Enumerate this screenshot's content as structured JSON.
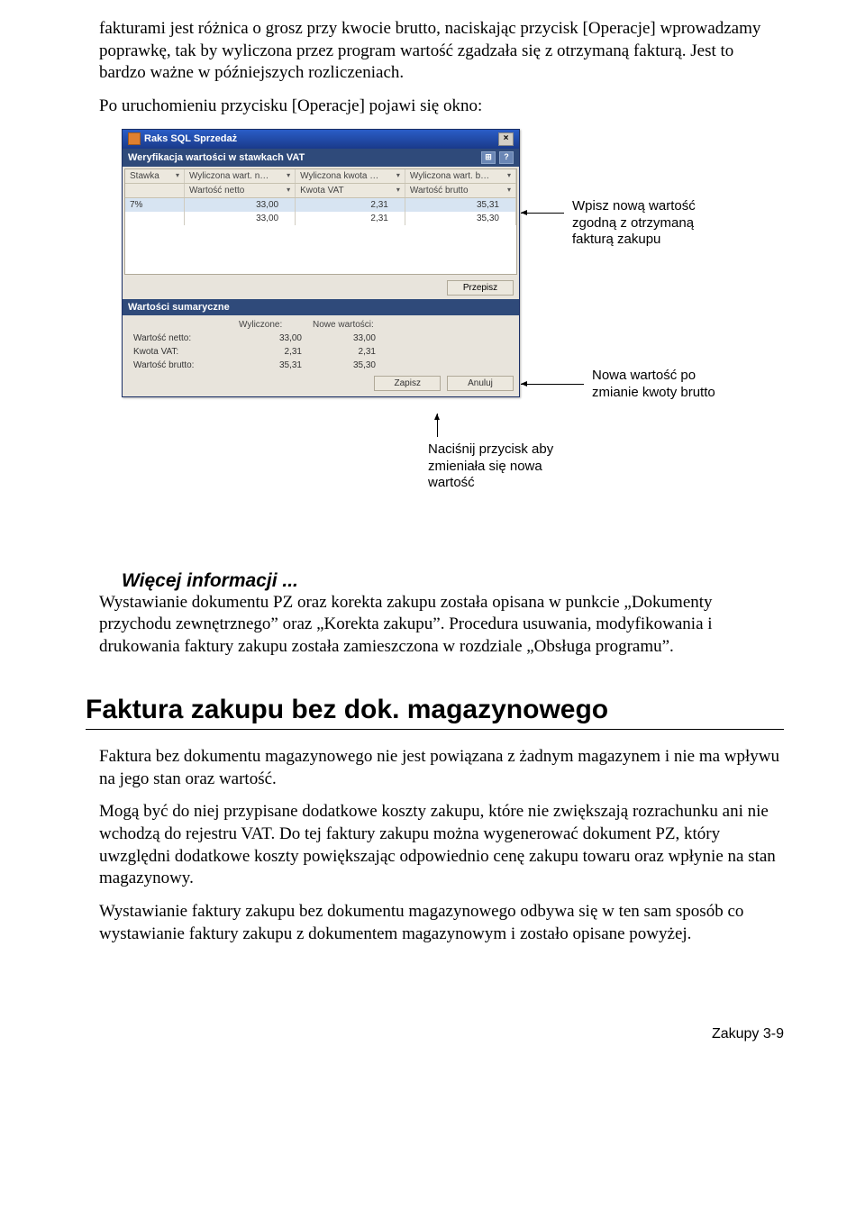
{
  "para1": "fakturami jest różnica o grosz przy kwocie brutto, naciskając przycisk [Operacje] wprowadzamy poprawkę, tak by wyliczona przez program wartość zgadzała się z otrzymaną fakturą. Jest to bardzo ważne w późniejszych rozliczeniach.",
  "para2": "Po uruchomieniu przycisku [Operacje] pojawi się okno:",
  "window": {
    "title": "Raks SQL Sprzedaż",
    "subtitle": "Weryfikacja wartości w stawkach VAT",
    "icon_help": "?",
    "icon_grid": "⊞",
    "headers_top": [
      "Stawka",
      "Wyliczona wart. n…",
      "Wyliczona kwota …",
      "Wyliczona wart. b…"
    ],
    "headers_bottom": [
      "",
      "Wartość netto",
      "Kwota VAT",
      "Wartość brutto"
    ],
    "rows": [
      [
        "7%",
        "33,00",
        "2,31",
        "35,31"
      ],
      [
        "",
        "33,00",
        "2,31",
        "35,30"
      ]
    ],
    "btn_przepisz": "Przepisz",
    "summary_title": "Wartości sumaryczne",
    "summary_cols": [
      "",
      "Wyliczone:",
      "Nowe wartości:"
    ],
    "summary_rows": [
      [
        "Wartość netto:",
        "33,00",
        "33,00"
      ],
      [
        "Kwota VAT:",
        "2,31",
        "2,31"
      ],
      [
        "Wartość brutto:",
        "35,31",
        "35,30"
      ]
    ],
    "btn_zapisz": "Zapisz",
    "btn_anuluj": "Anuluj"
  },
  "anno1": "Wpisz nową wartość zgodną z otrzymaną fakturą zakupu",
  "anno2": "Nowa wartość po zmianie kwoty brutto",
  "anno3": "Naciśnij przycisk aby zmieniała się nowa wartość",
  "more_info_head": "Więcej informacji ...",
  "more_info_body": "Wystawianie dokumentu PZ oraz korekta zakupu została opisana w punkcie „Dokumenty przychodu zewnętrznego” oraz „Korekta zakupu”. Procedura usuwania, modyfikowania i drukowania faktury zakupu została zamieszczona w rozdziale „Obsługa programu”.",
  "h1": "Faktura zakupu bez dok. magazynowego",
  "sec_p1": "Faktura bez dokumentu magazynowego nie jest powiązana z żadnym magazynem i nie ma wpływu na jego stan oraz wartość.",
  "sec_p2": "Mogą być do niej przypisane dodatkowe koszty zakupu, które nie zwiększają rozrachunku ani nie wchodzą do rejestru VAT. Do tej faktury zakupu można wygenerować dokument PZ, który uwzględni dodatkowe koszty powiększając odpowiednio cenę zakupu towaru oraz wpłynie na stan magazynowy.",
  "sec_p3": "Wystawianie faktury zakupu bez dokumentu magazynowego odbywa się w ten sam sposób co wystawianie faktury zakupu z dokumentem magazynowym i zostało opisane powyżej.",
  "footer": "Zakupy   3-9"
}
